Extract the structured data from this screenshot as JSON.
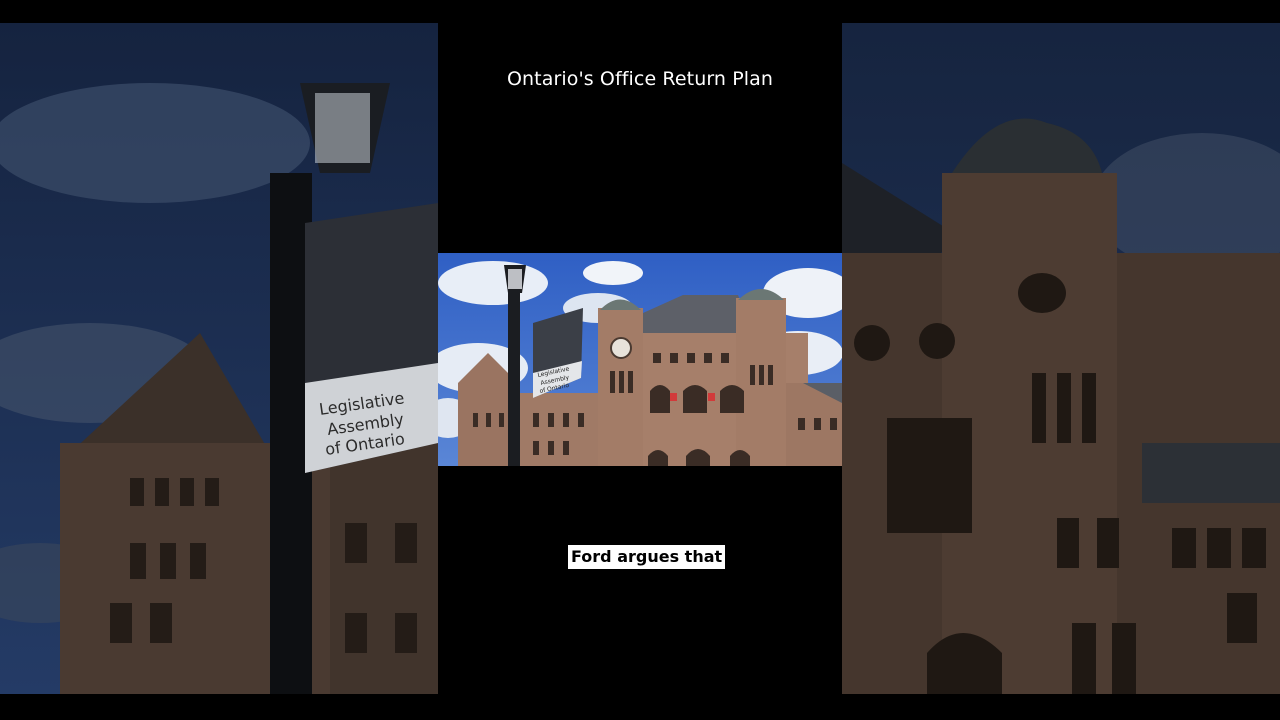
{
  "video": {
    "title": "Ontario's Office Return Plan",
    "caption": "Ford argues that",
    "sign_text": [
      "Legislative",
      "Assembly",
      "of Ontario"
    ]
  },
  "colors": {
    "sky": "#3f6fc9",
    "stone": "#9a7563",
    "background": "#000000",
    "caption_bg": "#ffffff"
  }
}
